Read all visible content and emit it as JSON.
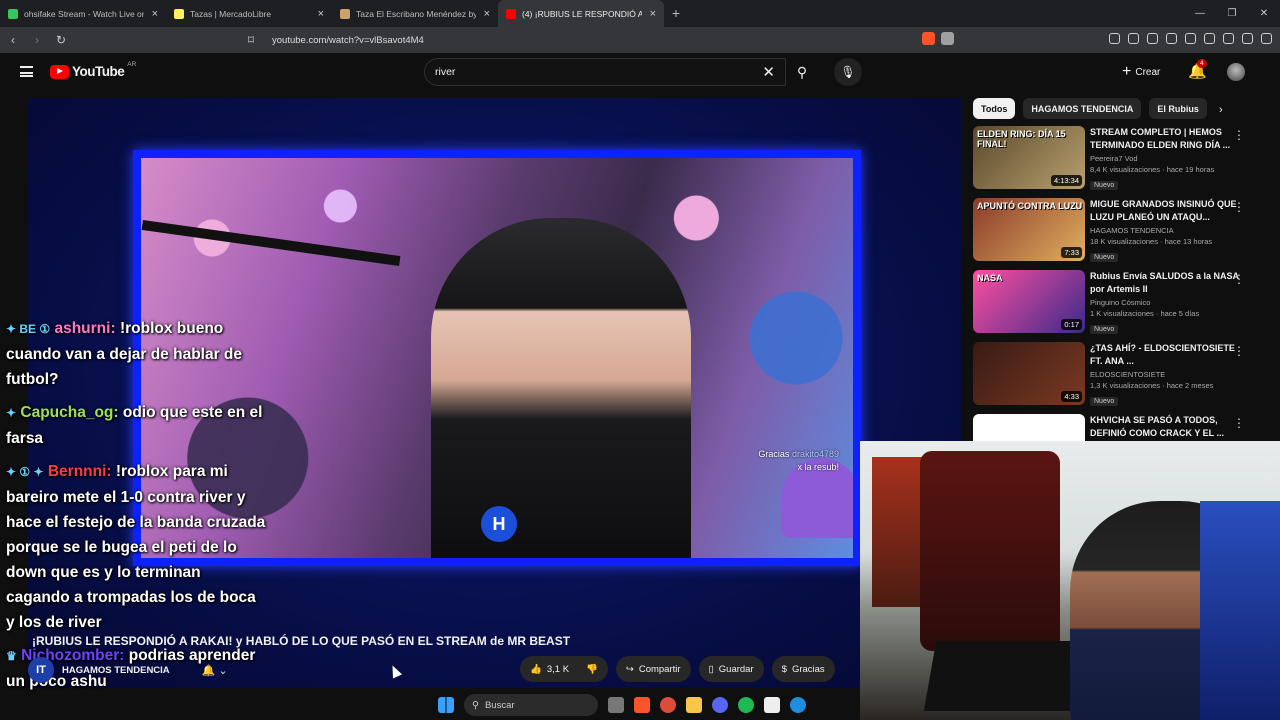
{
  "browser": {
    "tabs": [
      {
        "label": "ohsifake Stream - Watch Live on",
        "active": false,
        "color": "#35c759"
      },
      {
        "label": "Tazas | MercadoLibre",
        "active": false,
        "color": "#fff159"
      },
      {
        "label": "Taza El Escribano Menéndez by Prod",
        "active": false,
        "color": "#c9a36b"
      },
      {
        "label": "(4) ¡RUBIUS LE RESPONDIÓ A",
        "active": true,
        "color": "#ff0000"
      }
    ],
    "url": "youtube.com/watch?v=vlBsavot4M4"
  },
  "header": {
    "logo_text": "YouTube",
    "country": "AR",
    "search_value": "river",
    "create_label": "Crear",
    "notif_count": "4"
  },
  "player": {
    "sub_alert_line1": "Gracias",
    "sub_alert_user": "drakito4789",
    "sub_alert_line2": "x la resub!",
    "overlay_logo": "H"
  },
  "chat": [
    {
      "badges": "✦ BE ①",
      "name": "ashurni:",
      "text": "!roblox bueno cuando van a dejar de hablar de futbol?",
      "cls": "n1"
    },
    {
      "badges": "✦",
      "name": "Capucha_og:",
      "text": "odio que este en el farsa",
      "cls": "n2"
    },
    {
      "badges": "✦ ① ✦",
      "name": "Bernnni:",
      "text": "!roblox para mi bareiro mete el 1-0 contra river y hace el festejo de la banda cruzada porque se le bugea el peti de lo down que es y lo terminan cagando a trompadas los de boca y los de river",
      "cls": "n3"
    },
    {
      "badges": "♛",
      "name": "Nichozomber:",
      "text": "podrias aprender un poco ashu",
      "cls": "n4"
    }
  ],
  "video": {
    "title": "¡RUBIUS LE RESPONDIÓ A RAKAI! y HABLÓ DE LO QUE PASÓ EN EL STREAM de MR BEAST",
    "channel": "HAGAMOS TENDENCIA",
    "likes": "3,1 K",
    "share_label": "Compartir",
    "save_label": "Guardar",
    "thanks_label": "Gracias"
  },
  "sidebar": {
    "chips": [
      "Todos",
      "HAGAMOS TENDENCIA",
      "El Rubius"
    ],
    "recs": [
      {
        "title": "STREAM COMPLETO | HEMOS TERMINADO ELDEN RING DÍA ...",
        "channel": "Peereira7 Vod",
        "meta": "8,4 K visualizaciones · hace 19 horas",
        "badge": "Nuevo",
        "duration": "4:13:34",
        "thumb_text": "ELDEN RING: DÍA 15 FINAL!",
        "c1": "#5a4a2a",
        "c2": "#b8a070"
      },
      {
        "title": "MIGUE GRANADOS INSINUÓ QUE LUZU PLANEÓ UN ATAQU...",
        "channel": "HAGAMOS TENDENCIA",
        "meta": "18 K visualizaciones · hace 13 horas",
        "badge": "Nuevo",
        "duration": "7:33",
        "thumb_text": "APUNTÓ CONTRA LUZU",
        "c1": "#8a3a2a",
        "c2": "#e0b060"
      },
      {
        "title": "Rubius Envía SALUDOS a la NASA por Artemis II",
        "channel": "Pinguino Cósmico",
        "meta": "1 K visualizaciones · hace 5 días",
        "badge": "Nuevo",
        "duration": "0:17",
        "thumb_text": "NASA",
        "c1": "#ff4fa0",
        "c2": "#3a2a8a"
      },
      {
        "title": "¿TAS AHÍ? - ELDOSCIENTOSIETE FT. ANA ...",
        "channel": "ELDOSCIENTOSIETE",
        "meta": "1,3 K visualizaciones · hace 2 meses",
        "badge": "Nuevo",
        "duration": "4:33",
        "thumb_text": "",
        "c1": "#3a1a14",
        "c2": "#7a3a22"
      },
      {
        "title": "KHVICHA SE PASÓ A TODOS, DEFINIÓ COMO CRACK Y EL ...",
        "channel": "",
        "meta": "",
        "badge": "",
        "duration": "",
        "thumb_text": "",
        "c1": "#ffffff",
        "c2": "#ffffff"
      }
    ]
  },
  "taskbar": {
    "search_placeholder": "Buscar"
  }
}
